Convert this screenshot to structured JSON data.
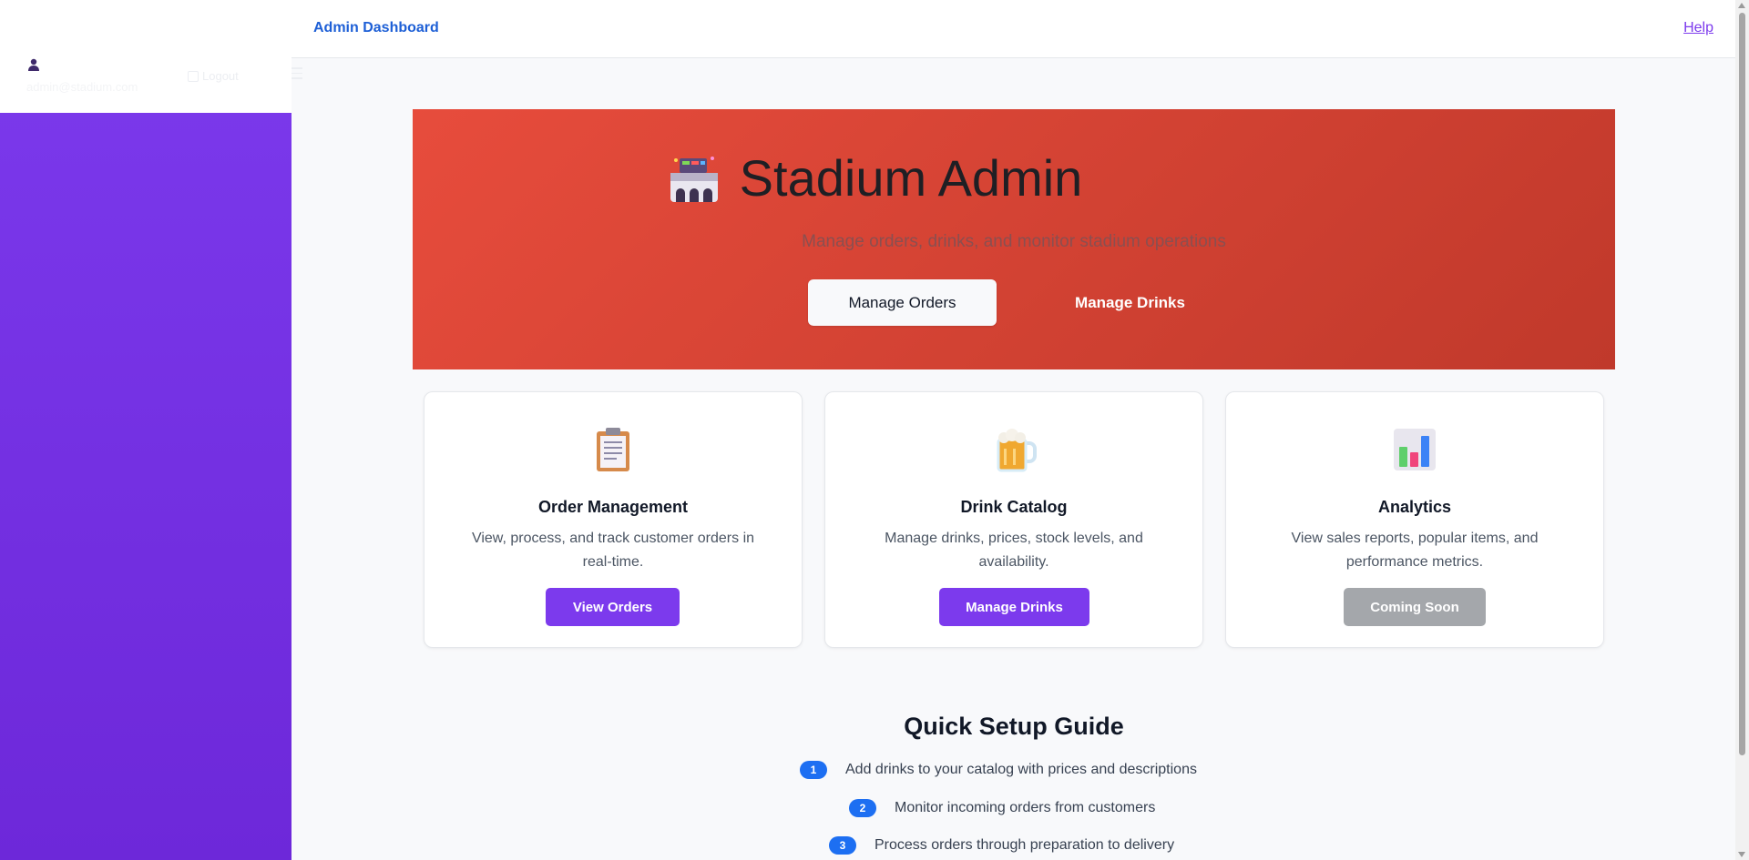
{
  "sidebar": {
    "user_email": "admin@stadium.com",
    "logout_label": "Logout",
    "user_icon": "user-icon",
    "logout_icon": "logout-icon",
    "menu_icon": "menu-icon"
  },
  "topbar": {
    "title": "Admin Dashboard",
    "help": "Help"
  },
  "hero": {
    "title": "Stadium Admin",
    "subtitle": "Manage orders, drinks, and monitor stadium operations",
    "btn_orders": "Manage Orders",
    "btn_drinks": "Manage Drinks"
  },
  "cards": [
    {
      "icon": "clipboard-icon",
      "title": "Order Management",
      "description": "View, process, and track customer orders in real-time.",
      "button": "View Orders"
    },
    {
      "icon": "beer-mug-icon",
      "title": "Drink Catalog",
      "description": "Manage drinks, prices, stock levels, and availability.",
      "button": "Manage Drinks"
    },
    {
      "icon": "bar-chart-icon",
      "title": "Analytics",
      "description": "View sales reports, popular items, and performance metrics.",
      "button": "Coming Soon"
    }
  ],
  "guide": {
    "title": "Quick Setup Guide",
    "steps": [
      {
        "num": "1",
        "text": "Add drinks to your catalog with prices and descriptions"
      },
      {
        "num": "2",
        "text": "Monitor incoming orders from customers"
      },
      {
        "num": "3",
        "text": "Process orders through preparation to delivery"
      }
    ]
  },
  "colors": {
    "primary": "#7c3aed",
    "hero_start": "#e74c3c",
    "hero_end": "#c0392b",
    "link_blue": "#1d5fd6",
    "step_badge": "#1d6ff2",
    "disabled_button": "#a4a7ab"
  }
}
